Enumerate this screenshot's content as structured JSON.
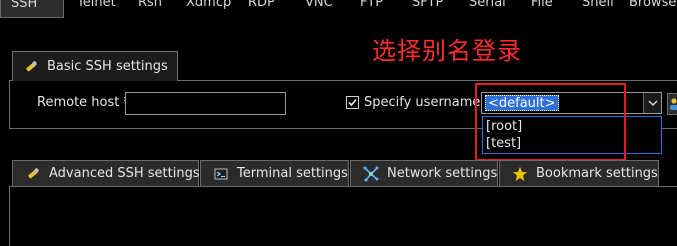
{
  "protocol_tabs": [
    {
      "label": "SSH",
      "active": true
    },
    {
      "label": "Telnet"
    },
    {
      "label": "Rsh"
    },
    {
      "label": "Xdmcp"
    },
    {
      "label": "RDP"
    },
    {
      "label": "VNC"
    },
    {
      "label": "FTP"
    },
    {
      "label": "SFTP"
    },
    {
      "label": "Serial"
    },
    {
      "label": "File"
    },
    {
      "label": "Shell"
    },
    {
      "label": "Browser"
    }
  ],
  "annotation": "选择别名登录",
  "basic_tab": {
    "label": "Basic SSH settings",
    "icon": "wrench-icon"
  },
  "remote_host": {
    "label": "Remote host *",
    "value": ""
  },
  "specify_username": {
    "label": "Specify username",
    "checked": true
  },
  "username_select": {
    "selected": "<default>",
    "options": [
      "[root]",
      "[test]"
    ]
  },
  "lower_tabs": [
    {
      "label": "Advanced SSH settings",
      "icon": "wrench-icon"
    },
    {
      "label": "Terminal settings",
      "icon": "terminal-icon"
    },
    {
      "label": "Network settings",
      "icon": "network-icon"
    },
    {
      "label": "Bookmark settings",
      "icon": "star-icon"
    }
  ],
  "colors": {
    "annotation": "#ff2b2b",
    "highlight": "#2f6fd6",
    "red_box": "#e51b1b"
  }
}
